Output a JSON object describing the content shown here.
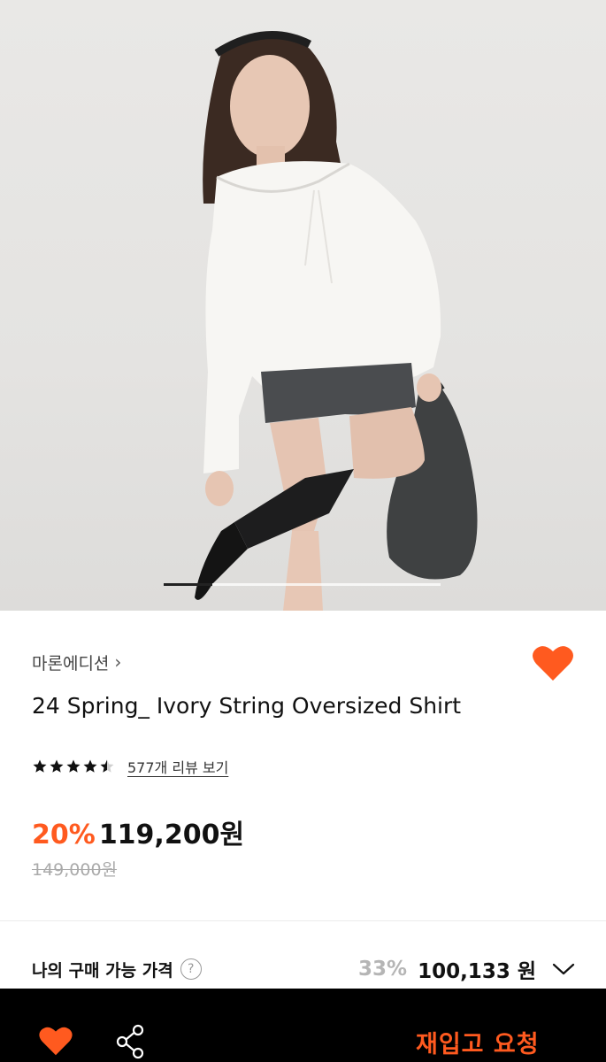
{
  "product": {
    "brand": "마론에디션",
    "brand_chevron": "›",
    "title": "24 Spring_ Ivory String Oversized Shirt",
    "rating": 4.5,
    "review_link": "577개 리뷰 보기",
    "discount": "20%",
    "price": "119,200원",
    "original_price": "149,000원"
  },
  "my_price": {
    "label": "나의 구매 가능 가격",
    "help": "?",
    "discount": "33%",
    "price": "100,133 원"
  },
  "gallery": {
    "progress": 0.175
  },
  "bottom_bar": {
    "restock_label": "재입고 요청"
  },
  "colors": {
    "accent": "#ff5a1f",
    "bar_bg": "#000000"
  },
  "icons": {
    "wish": "heart-icon",
    "share": "share-icon",
    "expand": "chevron-down-icon",
    "help": "question-circle-icon",
    "rating": "star-icon"
  }
}
